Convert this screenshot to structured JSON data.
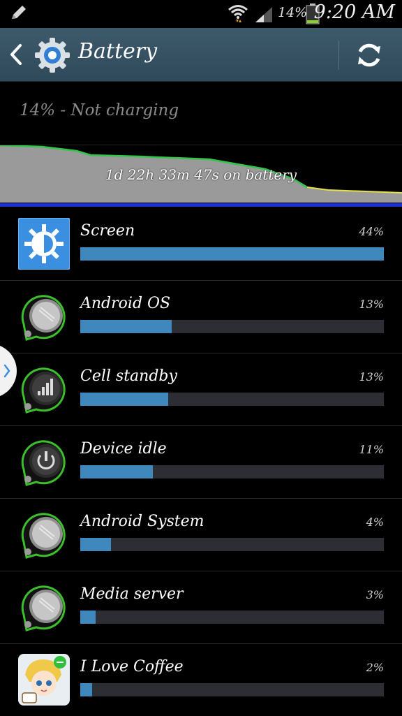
{
  "status_bar": {
    "battery_percent": "14%",
    "time": "9:20 AM",
    "icons": [
      "pencil-icon",
      "wifi-icon",
      "signal-icon",
      "battery-icon"
    ]
  },
  "action_bar": {
    "title": "Battery",
    "icons": [
      "back-icon",
      "settings-gear-icon",
      "refresh-icon"
    ]
  },
  "summary": {
    "charge_status": "14% - Not charging",
    "on_battery": "1d 22h 33m 47s on battery"
  },
  "colors": {
    "accent_bar": "#3f88be",
    "graph_line": "#1a2fd6",
    "action_bar": "#365262"
  },
  "items": [
    {
      "name": "Screen",
      "percent": "44%",
      "level": 1.0,
      "icon": "screen-brightness-icon"
    },
    {
      "name": "Android OS",
      "percent": "13%",
      "level": 0.3,
      "icon": "android-os-icon"
    },
    {
      "name": "Cell standby",
      "percent": "13%",
      "level": 0.29,
      "icon": "cell-standby-icon"
    },
    {
      "name": "Device idle",
      "percent": "11%",
      "level": 0.24,
      "icon": "device-idle-icon"
    },
    {
      "name": "Android System",
      "percent": "4%",
      "level": 0.1,
      "icon": "android-system-icon"
    },
    {
      "name": "Media server",
      "percent": "3%",
      "level": 0.05,
      "icon": "media-server-icon"
    },
    {
      "name": "I Love Coffee",
      "percent": "2%",
      "level": 0.04,
      "icon": "i-love-coffee-app-icon"
    }
  ]
}
